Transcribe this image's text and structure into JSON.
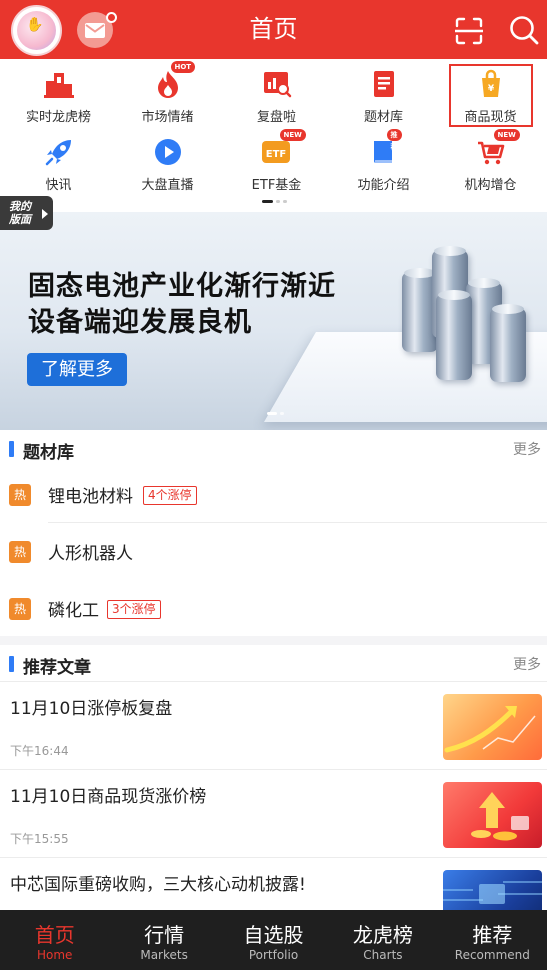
{
  "header": {
    "title": "首页"
  },
  "menu": {
    "items": [
      {
        "label": "实时龙虎榜",
        "icon": "podium-icon"
      },
      {
        "label": "市场情绪",
        "icon": "flame-icon",
        "tag": "HOT"
      },
      {
        "label": "复盘啦",
        "icon": "chart-search-icon"
      },
      {
        "label": "题材库",
        "icon": "document-icon"
      },
      {
        "label": "商品现货",
        "icon": "shopping-bag-icon"
      },
      {
        "label": "快讯",
        "icon": "rocket-icon"
      },
      {
        "label": "大盘直播",
        "icon": "play-icon"
      },
      {
        "label": "ETF基金",
        "icon": "etf-icon",
        "tag": "NEW"
      },
      {
        "label": "功能介绍",
        "icon": "book-icon",
        "tag": "推荐"
      },
      {
        "label": "机构增仓",
        "icon": "cart-icon",
        "tag": "NEW"
      }
    ],
    "my_layout_line1": "我的",
    "my_layout_line2": "版面"
  },
  "banner": {
    "line1": "固态电池产业化渐行渐近",
    "line2": "设备端迎发展良机",
    "button": "了解更多"
  },
  "topics": {
    "title": "题材库",
    "more": "更多",
    "hot_label": "热",
    "items": [
      {
        "name": "锂电池材料",
        "limit": "4个涨停"
      },
      {
        "name": "人形机器人",
        "limit": ""
      },
      {
        "name": "磷化工",
        "limit": "3个涨停"
      }
    ]
  },
  "articles": {
    "title": "推荐文章",
    "more": "更多",
    "items": [
      {
        "title": "11月10日涨停板复盘",
        "time": "下午16:44"
      },
      {
        "title": "11月10日商品现货涨价榜",
        "time": "下午15:55"
      },
      {
        "title": "中芯国际重磅收购，三大核心动机披露!",
        "time": ""
      }
    ]
  },
  "tabbar": {
    "tabs": [
      {
        "label": "首页",
        "sub": "Home"
      },
      {
        "label": "行情",
        "sub": "Markets"
      },
      {
        "label": "自选股",
        "sub": "Portfolio"
      },
      {
        "label": "龙虎榜",
        "sub": "Charts"
      },
      {
        "label": "推荐",
        "sub": "Recommend"
      }
    ]
  },
  "colors": {
    "brand_red": "#e8362d",
    "accent_blue": "#2f7cf6",
    "hot_orange": "#f08a2c"
  }
}
